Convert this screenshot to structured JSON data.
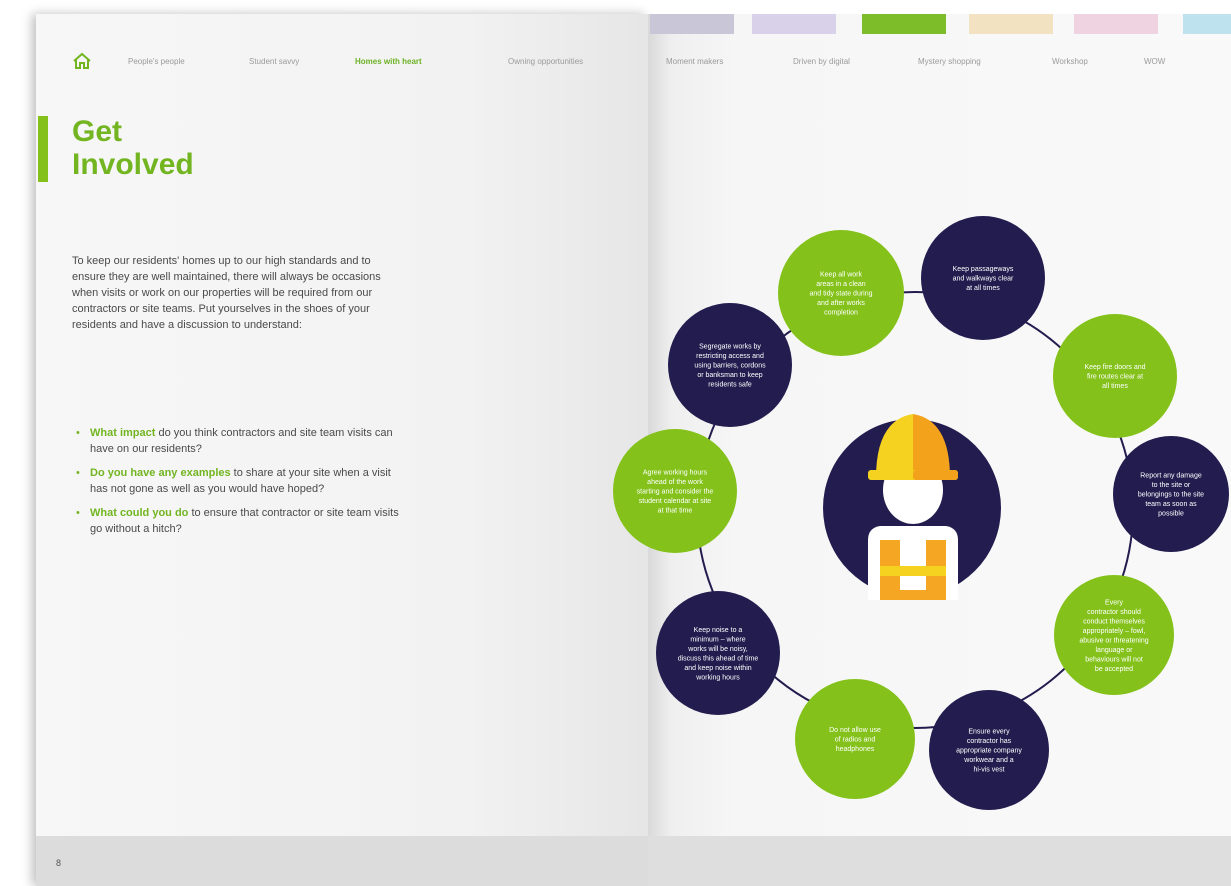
{
  "nav": {
    "items": [
      "People's people",
      "Student savvy",
      "Homes with heart",
      "Owning opportunities",
      "Moment makers",
      "Driven by digital",
      "Mystery shopping",
      "Workshop",
      "WOW"
    ],
    "active": "Homes with heart"
  },
  "header": {
    "tab_colors": [
      "#c9c6d8",
      "#d9d1ea",
      "#7dbd2a",
      "#f2e2c2",
      "#f0d3e0",
      "#bfe3ee"
    ]
  },
  "title": {
    "line1": "Get",
    "line2": "Involved"
  },
  "intro": "To keep our residents' homes up to our high standards and to ensure they are well maintained, there will always be occasions when visits or work on our properties will be required from our contractors or site teams. Put yourselves in the shoes of your residents and have a discussion to understand:",
  "bullets": [
    {
      "highlight": "What impact",
      "rest": " do you think contractors and site team visits can have on our residents?"
    },
    {
      "highlight": "Do you have any examples",
      "rest": " to share at your site when a visit has not gone as well as you would have hoped?"
    },
    {
      "highlight": "What could you do",
      "rest": " to ensure that contractor or site team visits go without a hitch?"
    }
  ],
  "page_number": "8",
  "diagram": {
    "center_icon": "construction-worker-icon",
    "colors": {
      "green": "#84c21b",
      "navy": "#231c4f",
      "helmet_yellow": "#f5d21f",
      "helmet_orange": "#f2a21b",
      "vest_orange": "#f5a623"
    },
    "circles": [
      {
        "color": "green",
        "lines": [
          "Keep all work",
          "areas in a clean",
          "and tidy state during",
          "and after works",
          "completion"
        ]
      },
      {
        "color": "navy",
        "lines": [
          "Keep passageways",
          "and walkways clear",
          "at all times"
        ]
      },
      {
        "color": "green",
        "lines": [
          "Keep fire doors and",
          "fire routes clear at",
          "all times"
        ]
      },
      {
        "color": "navy",
        "lines": [
          "Report any damage",
          "to the site or",
          "belongings to the site",
          "team as soon as",
          "possible"
        ]
      },
      {
        "color": "green",
        "lines": [
          "Every",
          "contractor should",
          "conduct themselves",
          "appropriately – fowl,",
          "abusive or threatening",
          "language or",
          "behaviours will not",
          "be accepted"
        ]
      },
      {
        "color": "navy",
        "lines": [
          "Ensure every",
          "contractor has",
          "appropriate company",
          "workwear and a",
          "hi-vis vest"
        ]
      },
      {
        "color": "green",
        "lines": [
          "Do not allow use",
          "of radios and",
          "headphones"
        ]
      },
      {
        "color": "navy",
        "lines": [
          "Keep noise to a",
          "minimum – where",
          "works will be noisy,",
          "discuss this ahead of time",
          "and keep noise within",
          "working hours"
        ]
      },
      {
        "color": "green",
        "lines": [
          "Agree working hours",
          "ahead of the work",
          "starting and consider the",
          "student calendar at site",
          "at that time"
        ]
      },
      {
        "color": "navy",
        "lines": [
          "Segregate works by",
          "restricting access and",
          "using barriers, cordons",
          "or banksman to keep",
          "residents safe"
        ]
      }
    ]
  }
}
